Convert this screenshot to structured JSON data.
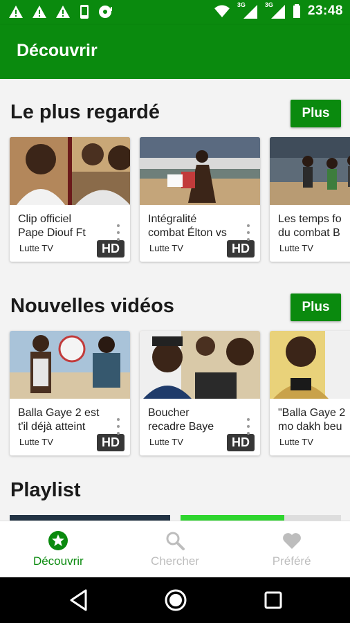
{
  "status_bar": {
    "time": "23:48",
    "network_1": "3G",
    "network_2": "3G",
    "icons": [
      "warning-icon",
      "warning-icon",
      "warning-icon",
      "phone-icon",
      "record-icon",
      "wifi-icon",
      "signal-icon",
      "battery-icon"
    ]
  },
  "app_bar": {
    "title": "Découvrir"
  },
  "sections": [
    {
      "title": "Le plus regardé",
      "more_label": "Plus",
      "videos": [
        {
          "title": "Clip officiel\nPape Diouf Ft",
          "channel": "Lutte TV",
          "badge": "HD"
        },
        {
          "title": "Intégralité\ncombat Élton vs",
          "channel": "Lutte TV",
          "badge": "HD"
        },
        {
          "title": "Les temps fo\ndu combat B",
          "channel": "Lutte TV",
          "badge": ""
        }
      ]
    },
    {
      "title": "Nouvelles vidéos",
      "more_label": "Plus",
      "videos": [
        {
          "title": "Balla Gaye 2 est\nt'il déjà atteint",
          "channel": "Lutte TV",
          "badge": "HD"
        },
        {
          "title": "Boucher\nrecadre Baye",
          "channel": "Lutte TV",
          "badge": "HD"
        },
        {
          "title": "\"Balla Gaye 2\nmo dakh beu",
          "channel": "Lutte TV",
          "badge": ""
        }
      ]
    }
  ],
  "playlist": {
    "title": "Playlist"
  },
  "bottom_nav": {
    "items": [
      {
        "label": "Découvrir",
        "icon": "star-icon",
        "active": true
      },
      {
        "label": "Chercher",
        "icon": "search-icon",
        "active": false
      },
      {
        "label": "Préféré",
        "icon": "heart-icon",
        "active": false
      }
    ]
  },
  "colors": {
    "primary": "#0a8a0e",
    "inactive": "#bdbdbd",
    "background": "#f3f3f3"
  }
}
